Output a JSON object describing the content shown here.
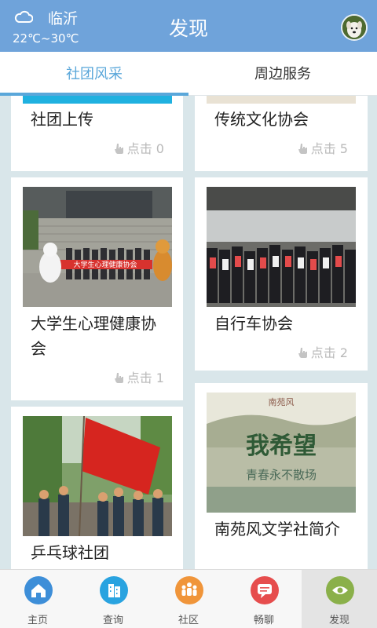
{
  "header": {
    "city": "临沂",
    "temperature": "22℃~30℃",
    "title": "发现",
    "weather_icon": "cloud-icon",
    "avatar": "dog-avatar"
  },
  "tabs": [
    {
      "label": "社团风采",
      "active": true
    },
    {
      "label": "周边服务",
      "active": false
    }
  ],
  "cards": [
    {
      "title": "社团上传",
      "clicks": "点击 0"
    },
    {
      "title": "传统文化协会",
      "clicks": "点击 5"
    },
    {
      "title": "大学生心理健康协会",
      "clicks": "点击 1",
      "banner": "大学生心理健康协会"
    },
    {
      "title": "自行车协会",
      "clicks": "点击 2"
    },
    {
      "title": "乒乓球社团",
      "clicks": ""
    },
    {
      "title": "南苑风文学社简介",
      "clicks": "",
      "image_text_1": "我希望",
      "image_text_2": "青春永不散场",
      "image_text_3": "南苑风"
    }
  ],
  "nav": [
    {
      "label": "主页",
      "icon": "home-icon",
      "color": "#3d8ed8"
    },
    {
      "label": "查询",
      "icon": "building-icon",
      "color": "#29a3e0"
    },
    {
      "label": "社区",
      "icon": "people-icon",
      "color": "#f0953a"
    },
    {
      "label": "畅聊",
      "icon": "chat-icon",
      "color": "#e64d4d"
    },
    {
      "label": "发现",
      "icon": "eye-icon",
      "color": "#8ab04a",
      "active": true
    }
  ],
  "colors": {
    "header": "#6fa3da",
    "accent": "#5aa7da",
    "background": "#d9e6ea"
  }
}
